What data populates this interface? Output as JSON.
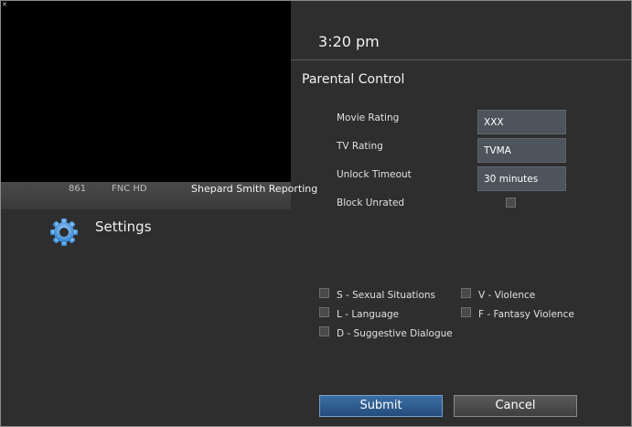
{
  "clock": "3:20 pm",
  "channel": {
    "number": "861",
    "name": "FNC HD",
    "program": "Shepard Smith Reporting"
  },
  "menu": {
    "title": "Settings",
    "icon": "gear-icon"
  },
  "panel": {
    "title": "Parental Control",
    "fields": [
      {
        "label": "Movie Rating",
        "value": "XXX"
      },
      {
        "label": "TV Rating",
        "value": "TVMA"
      },
      {
        "label": "Unlock Timeout",
        "value": "30 minutes"
      }
    ],
    "block_unrated": {
      "label": "Block Unrated",
      "checked": false
    },
    "content_flags": [
      {
        "label": "S - Sexual Situations",
        "checked": false
      },
      {
        "label": "V - Violence",
        "checked": false
      },
      {
        "label": "L - Language",
        "checked": false
      },
      {
        "label": "F - Fantasy Violence",
        "checked": false
      },
      {
        "label": "D - Suggestive Dialogue",
        "checked": false
      }
    ]
  },
  "buttons": {
    "submit": "Submit",
    "cancel": "Cancel"
  },
  "colors": {
    "background": "#2e2e2e",
    "field": "#4d545b",
    "submit": "#2f5f92",
    "cancel": "#4a4a4a"
  }
}
